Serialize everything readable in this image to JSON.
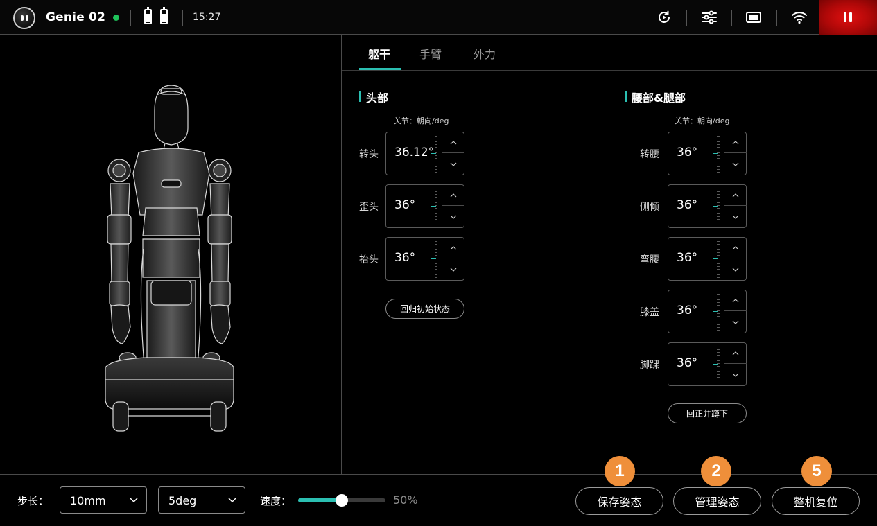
{
  "header": {
    "robot_name": "Genie 02",
    "time": "15:27",
    "status_color": "#1fc25a",
    "icons": [
      "replay-icon",
      "settings-sliders-icon",
      "display-icon",
      "wifi-icon"
    ]
  },
  "tabs": [
    {
      "label": "躯干",
      "active": true
    },
    {
      "label": "手臂",
      "active": false
    },
    {
      "label": "外力",
      "active": false
    }
  ],
  "head_section": {
    "title": "头部",
    "caption": "关节：朝向/deg",
    "joints": [
      {
        "label": "转头",
        "value": "36.12°"
      },
      {
        "label": "歪头",
        "value": "36°"
      },
      {
        "label": "抬头",
        "value": "36°"
      }
    ],
    "reset_label": "回归初始状态"
  },
  "waist_section": {
    "title": "腰部&腿部",
    "caption": "关节：朝向/deg",
    "joints": [
      {
        "label": "转腰",
        "value": "36°"
      },
      {
        "label": "侧倾",
        "value": "36°"
      },
      {
        "label": "弯腰",
        "value": "36°"
      },
      {
        "label": "膝盖",
        "value": "36°"
      },
      {
        "label": "脚踝",
        "value": "36°"
      }
    ],
    "reset_label": "回正并蹲下"
  },
  "bottom": {
    "step_label": "步长：",
    "step_mm": "10mm",
    "step_deg": "5deg",
    "speed_label": "速度：",
    "speed_percent": 50,
    "speed_text": "50%",
    "buttons": [
      {
        "label": "保存姿态",
        "badge": "1"
      },
      {
        "label": "管理姿态",
        "badge": "2"
      },
      {
        "label": "整机复位",
        "badge": "5"
      }
    ]
  },
  "colors": {
    "accent": "#2bbfb2",
    "badge": "#ef8f3a",
    "stop": "#d00c0c"
  }
}
